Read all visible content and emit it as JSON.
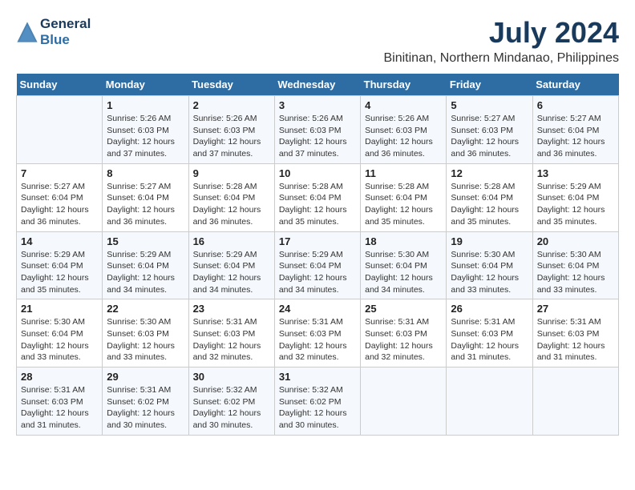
{
  "header": {
    "logo_line1": "General",
    "logo_line2": "Blue",
    "title": "July 2024",
    "subtitle": "Binitinan, Northern Mindanao, Philippines"
  },
  "days_of_week": [
    "Sunday",
    "Monday",
    "Tuesday",
    "Wednesday",
    "Thursday",
    "Friday",
    "Saturday"
  ],
  "weeks": [
    [
      {
        "day": "",
        "info": ""
      },
      {
        "day": "1",
        "info": "Sunrise: 5:26 AM\nSunset: 6:03 PM\nDaylight: 12 hours\nand 37 minutes."
      },
      {
        "day": "2",
        "info": "Sunrise: 5:26 AM\nSunset: 6:03 PM\nDaylight: 12 hours\nand 37 minutes."
      },
      {
        "day": "3",
        "info": "Sunrise: 5:26 AM\nSunset: 6:03 PM\nDaylight: 12 hours\nand 37 minutes."
      },
      {
        "day": "4",
        "info": "Sunrise: 5:26 AM\nSunset: 6:03 PM\nDaylight: 12 hours\nand 36 minutes."
      },
      {
        "day": "5",
        "info": "Sunrise: 5:27 AM\nSunset: 6:03 PM\nDaylight: 12 hours\nand 36 minutes."
      },
      {
        "day": "6",
        "info": "Sunrise: 5:27 AM\nSunset: 6:04 PM\nDaylight: 12 hours\nand 36 minutes."
      }
    ],
    [
      {
        "day": "7",
        "info": "Sunrise: 5:27 AM\nSunset: 6:04 PM\nDaylight: 12 hours\nand 36 minutes."
      },
      {
        "day": "8",
        "info": "Sunrise: 5:27 AM\nSunset: 6:04 PM\nDaylight: 12 hours\nand 36 minutes."
      },
      {
        "day": "9",
        "info": "Sunrise: 5:28 AM\nSunset: 6:04 PM\nDaylight: 12 hours\nand 36 minutes."
      },
      {
        "day": "10",
        "info": "Sunrise: 5:28 AM\nSunset: 6:04 PM\nDaylight: 12 hours\nand 35 minutes."
      },
      {
        "day": "11",
        "info": "Sunrise: 5:28 AM\nSunset: 6:04 PM\nDaylight: 12 hours\nand 35 minutes."
      },
      {
        "day": "12",
        "info": "Sunrise: 5:28 AM\nSunset: 6:04 PM\nDaylight: 12 hours\nand 35 minutes."
      },
      {
        "day": "13",
        "info": "Sunrise: 5:29 AM\nSunset: 6:04 PM\nDaylight: 12 hours\nand 35 minutes."
      }
    ],
    [
      {
        "day": "14",
        "info": "Sunrise: 5:29 AM\nSunset: 6:04 PM\nDaylight: 12 hours\nand 35 minutes."
      },
      {
        "day": "15",
        "info": "Sunrise: 5:29 AM\nSunset: 6:04 PM\nDaylight: 12 hours\nand 34 minutes."
      },
      {
        "day": "16",
        "info": "Sunrise: 5:29 AM\nSunset: 6:04 PM\nDaylight: 12 hours\nand 34 minutes."
      },
      {
        "day": "17",
        "info": "Sunrise: 5:29 AM\nSunset: 6:04 PM\nDaylight: 12 hours\nand 34 minutes."
      },
      {
        "day": "18",
        "info": "Sunrise: 5:30 AM\nSunset: 6:04 PM\nDaylight: 12 hours\nand 34 minutes."
      },
      {
        "day": "19",
        "info": "Sunrise: 5:30 AM\nSunset: 6:04 PM\nDaylight: 12 hours\nand 33 minutes."
      },
      {
        "day": "20",
        "info": "Sunrise: 5:30 AM\nSunset: 6:04 PM\nDaylight: 12 hours\nand 33 minutes."
      }
    ],
    [
      {
        "day": "21",
        "info": "Sunrise: 5:30 AM\nSunset: 6:04 PM\nDaylight: 12 hours\nand 33 minutes."
      },
      {
        "day": "22",
        "info": "Sunrise: 5:30 AM\nSunset: 6:03 PM\nDaylight: 12 hours\nand 33 minutes."
      },
      {
        "day": "23",
        "info": "Sunrise: 5:31 AM\nSunset: 6:03 PM\nDaylight: 12 hours\nand 32 minutes."
      },
      {
        "day": "24",
        "info": "Sunrise: 5:31 AM\nSunset: 6:03 PM\nDaylight: 12 hours\nand 32 minutes."
      },
      {
        "day": "25",
        "info": "Sunrise: 5:31 AM\nSunset: 6:03 PM\nDaylight: 12 hours\nand 32 minutes."
      },
      {
        "day": "26",
        "info": "Sunrise: 5:31 AM\nSunset: 6:03 PM\nDaylight: 12 hours\nand 31 minutes."
      },
      {
        "day": "27",
        "info": "Sunrise: 5:31 AM\nSunset: 6:03 PM\nDaylight: 12 hours\nand 31 minutes."
      }
    ],
    [
      {
        "day": "28",
        "info": "Sunrise: 5:31 AM\nSunset: 6:03 PM\nDaylight: 12 hours\nand 31 minutes."
      },
      {
        "day": "29",
        "info": "Sunrise: 5:31 AM\nSunset: 6:02 PM\nDaylight: 12 hours\nand 30 minutes."
      },
      {
        "day": "30",
        "info": "Sunrise: 5:32 AM\nSunset: 6:02 PM\nDaylight: 12 hours\nand 30 minutes."
      },
      {
        "day": "31",
        "info": "Sunrise: 5:32 AM\nSunset: 6:02 PM\nDaylight: 12 hours\nand 30 minutes."
      },
      {
        "day": "",
        "info": ""
      },
      {
        "day": "",
        "info": ""
      },
      {
        "day": "",
        "info": ""
      }
    ]
  ]
}
